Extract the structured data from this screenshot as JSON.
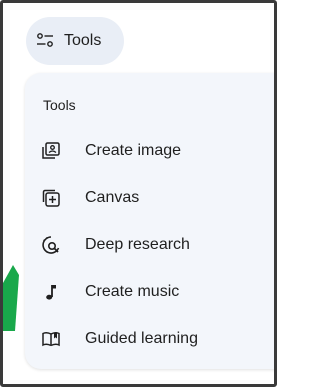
{
  "chip": {
    "label": "Tools",
    "icon": "tune-icon"
  },
  "menu": {
    "header": "Tools",
    "items": [
      {
        "label": "Create image",
        "icon": "image-gallery-icon"
      },
      {
        "label": "Canvas",
        "icon": "canvas-icon"
      },
      {
        "label": "Deep research",
        "icon": "deep-research-icon"
      },
      {
        "label": "Create music",
        "icon": "music-note-icon"
      },
      {
        "label": "Guided learning",
        "icon": "book-icon"
      }
    ]
  },
  "colors": {
    "chip_bg": "#e9eef6",
    "menu_bg": "#f3f6fb",
    "text": "#1f1f1f",
    "accent_green": "#19a84b",
    "frame": "#3a3a3a"
  }
}
